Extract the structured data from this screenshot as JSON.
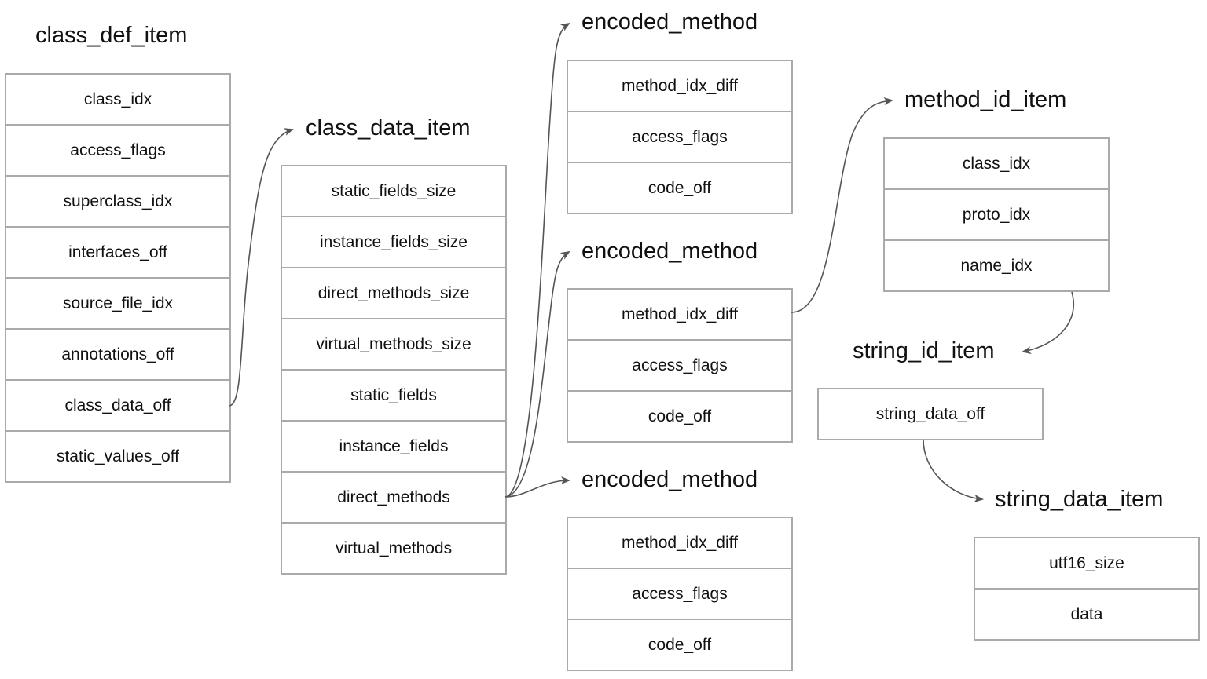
{
  "structures": {
    "class_def_item": {
      "title": "class_def_item",
      "fields": [
        "class_idx",
        "access_flags",
        "superclass_idx",
        "interfaces_off",
        "source_file_idx",
        "annotations_off",
        "class_data_off",
        "static_values_off"
      ]
    },
    "class_data_item": {
      "title": "class_data_item",
      "fields": [
        "static_fields_size",
        "instance_fields_size",
        "direct_methods_size",
        "virtual_methods_size",
        "static_fields",
        "instance_fields",
        "direct_methods",
        "virtual_methods"
      ]
    },
    "encoded_method_1": {
      "title": "encoded_method",
      "fields": [
        "method_idx_diff",
        "access_flags",
        "code_off"
      ]
    },
    "encoded_method_2": {
      "title": "encoded_method",
      "fields": [
        "method_idx_diff",
        "access_flags",
        "code_off"
      ]
    },
    "encoded_method_3": {
      "title": "encoded_method",
      "fields": [
        "method_idx_diff",
        "access_flags",
        "code_off"
      ]
    },
    "method_id_item": {
      "title": "method_id_item",
      "fields": [
        "class_idx",
        "proto_idx",
        "name_idx"
      ]
    },
    "string_id_item": {
      "title": "string_id_item",
      "fields": [
        "string_data_off"
      ]
    },
    "string_data_item": {
      "title": "string_data_item",
      "fields": [
        "utf16_size",
        "data"
      ]
    }
  },
  "connections": [
    {
      "from": "class_def_item.class_data_off",
      "to": "class_data_item"
    },
    {
      "from": "class_data_item.direct_methods",
      "to": "encoded_method_1"
    },
    {
      "from": "class_data_item.direct_methods",
      "to": "encoded_method_2"
    },
    {
      "from": "class_data_item.direct_methods",
      "to": "encoded_method_3"
    },
    {
      "from": "encoded_method_2.method_idx_diff",
      "to": "method_id_item"
    },
    {
      "from": "method_id_item.name_idx",
      "to": "string_id_item"
    },
    {
      "from": "string_id_item.string_data_off",
      "to": "string_data_item"
    }
  ],
  "colors": {
    "border": "#aaaaaa",
    "arrow": "#555555",
    "text": "#111111"
  }
}
